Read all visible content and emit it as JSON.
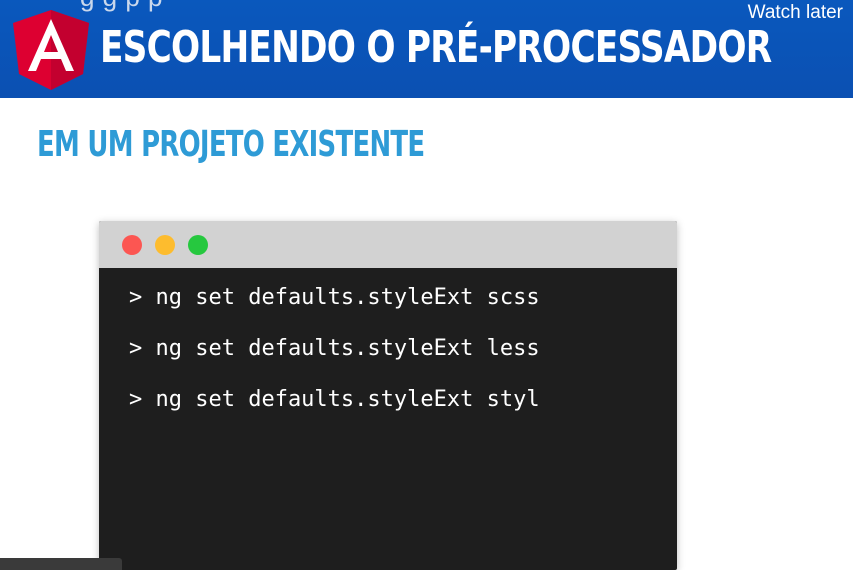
{
  "header": {
    "top_overflow_text": "g    g        p   p",
    "title": "ESCOLHENDO O PRÉ-PROCESSADOR",
    "watch_later": "Watch later",
    "logo_letter": "A"
  },
  "content": {
    "subtitle": "EM UM PROJETO EXISTENTE"
  },
  "terminal": {
    "commands": [
      "> ng set defaults.styleExt scss",
      "> ng set defaults.styleExt less",
      "> ng set defaults.styleExt styl"
    ]
  },
  "colors": {
    "header_blue": "#0b55b8",
    "subtitle_blue": "#2e9bd6",
    "terminal_bg": "#1e1e1e",
    "angular_red": "#dd0031"
  },
  "icons": {
    "logo": "angular-logo-icon",
    "window_controls": [
      "close-dot-icon",
      "minimize-dot-icon",
      "maximize-dot-icon"
    ]
  }
}
